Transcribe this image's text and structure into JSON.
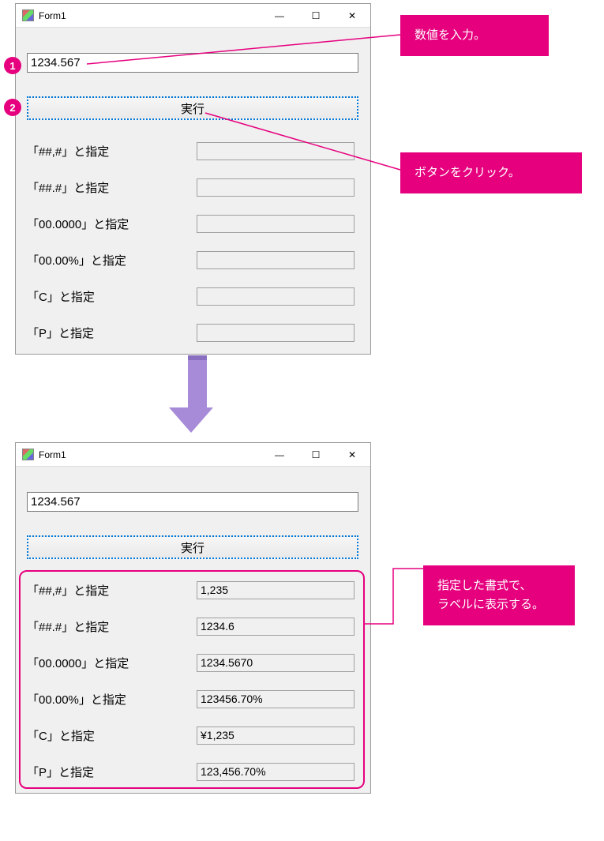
{
  "winTitle": "Form1",
  "inputValue": "1234.567",
  "runLabel": "実行",
  "rowLabels": {
    "r1": "「##,#」と指定",
    "r2": "「##.#」と指定",
    "r3": "「00.0000」と指定",
    "r4": "「00.00%」と指定",
    "r5": "「C」と指定",
    "r6": "「P」と指定"
  },
  "results": {
    "r1": "1,235",
    "r2": "1234.6",
    "r3": "1234.5670",
    "r4": "123456.70%",
    "r5": "¥1,235",
    "r6": "123,456.70%"
  },
  "callouts": {
    "c1": "数値を入力。",
    "c2": "ボタンをクリック。",
    "c3a": "指定した書式で、",
    "c3b": "ラベルに表示する。"
  },
  "badge1": "1",
  "badge2": "2",
  "ctl": {
    "min": "—",
    "max": "☐",
    "close": "✕"
  }
}
